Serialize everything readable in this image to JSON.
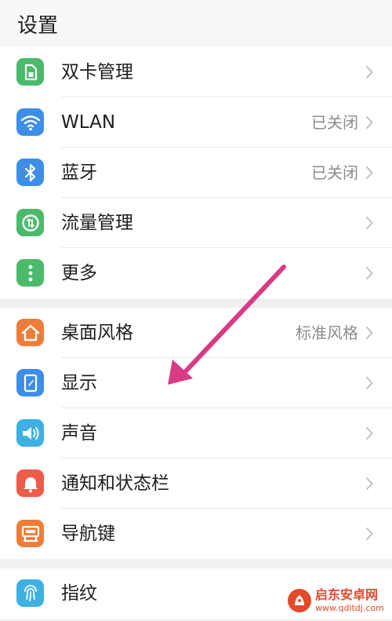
{
  "header": {
    "title": "设置"
  },
  "groups": [
    {
      "items": [
        {
          "label": "双卡管理",
          "value": "",
          "icon": "sim-card-icon",
          "color": "#4cba6b"
        },
        {
          "label": "WLAN",
          "value": "已关闭",
          "icon": "wifi-icon",
          "color": "#3c8ee6"
        },
        {
          "label": "蓝牙",
          "value": "已关闭",
          "icon": "bluetooth-icon",
          "color": "#3c8ee6"
        },
        {
          "label": "流量管理",
          "value": "",
          "icon": "data-usage-icon",
          "color": "#4cba6b"
        },
        {
          "label": "更多",
          "value": "",
          "icon": "more-icon",
          "color": "#4cba6b"
        }
      ]
    },
    {
      "items": [
        {
          "label": "桌面风格",
          "value": "标准风格",
          "icon": "home-icon",
          "color": "#ee7d3a"
        },
        {
          "label": "显示",
          "value": "",
          "icon": "display-icon",
          "color": "#3c8ee6"
        },
        {
          "label": "声音",
          "value": "",
          "icon": "sound-icon",
          "color": "#3fb0e2"
        },
        {
          "label": "通知和状态栏",
          "value": "",
          "icon": "bell-icon",
          "color": "#ef5b4a"
        },
        {
          "label": "导航键",
          "value": "",
          "icon": "navigation-key-icon",
          "color": "#ee7d3a"
        }
      ]
    },
    {
      "items": [
        {
          "label": "指纹",
          "value": "",
          "icon": "fingerprint-icon",
          "color": "#3fb0e2"
        }
      ]
    }
  ],
  "annotation": {
    "color": "#d93a84"
  },
  "watermark": {
    "name": "启东安卓网",
    "url": "www.qdltdj.com",
    "color": "#e24a2b"
  }
}
